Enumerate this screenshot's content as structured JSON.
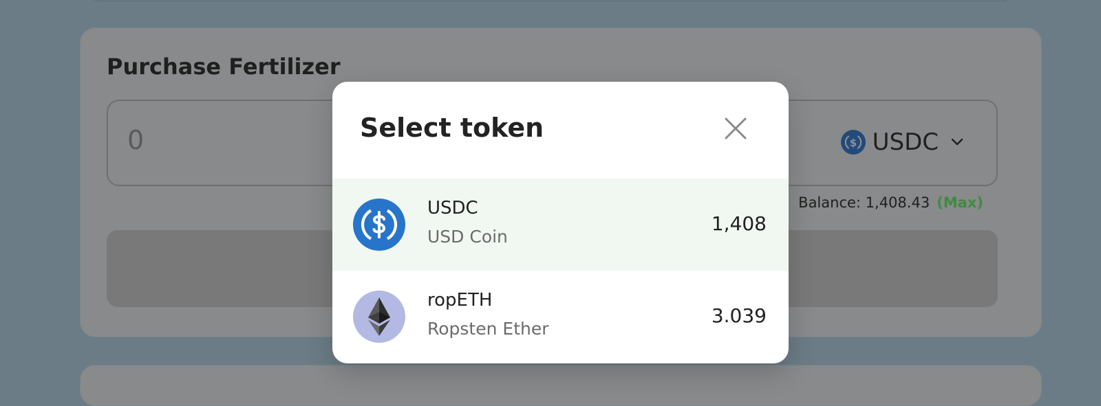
{
  "purchase": {
    "title": "Purchase Fertilizer",
    "amount": "0",
    "selected_token": "USDC",
    "balance_text": "Balance: 1,408.43",
    "max_label": "(Max)"
  },
  "modal": {
    "title": "Select token",
    "tokens": [
      {
        "symbol": "USDC",
        "name": "USD Coin",
        "balance": "1,408",
        "icon": "usdc-icon",
        "selected": true
      },
      {
        "symbol": "ropETH",
        "name": "Ropsten Ether",
        "balance": "3.039",
        "icon": "ethereum-icon",
        "selected": false
      }
    ]
  },
  "colors": {
    "overlay": "#6b7c86",
    "usdc_blue": "#2775ca",
    "eth_circle": "#b3b9e3",
    "selected_row": "#f0f8f1",
    "max_green": "#3f8a44"
  }
}
